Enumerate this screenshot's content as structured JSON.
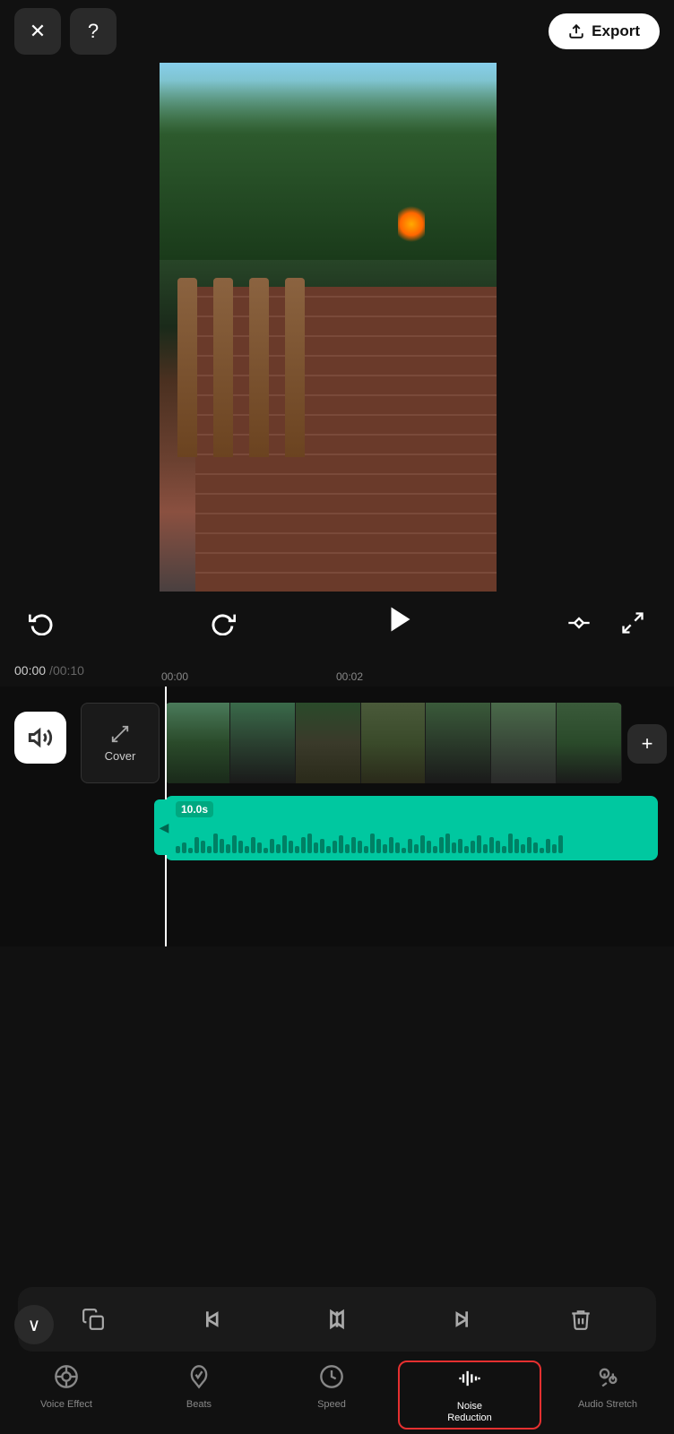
{
  "topBar": {
    "closeLabel": "✕",
    "helpLabel": "?",
    "exportLabel": "Export"
  },
  "playback": {
    "currentTime": "00:00",
    "totalTime": "00:10",
    "separator": "/",
    "markerTime1": "00:00",
    "markerTime2": "00:02"
  },
  "timeline": {
    "coverLabel": "Cover",
    "audioDuration": "10.0s",
    "addLabel": "+"
  },
  "toolbar": {
    "tools": [
      {
        "name": "copy",
        "icon": "⊕"
      },
      {
        "name": "trim-start",
        "icon": "⊣"
      },
      {
        "name": "split",
        "icon": "⊢⊣"
      },
      {
        "name": "trim-end",
        "icon": "⊢"
      },
      {
        "name": "delete",
        "icon": "🗑"
      }
    ]
  },
  "bottomNav": {
    "items": [
      {
        "id": "voice-effect",
        "label": "Voice Effect",
        "active": false,
        "highlighted": false
      },
      {
        "id": "beats",
        "label": "Beats",
        "active": false,
        "highlighted": false
      },
      {
        "id": "speed",
        "label": "Speed",
        "active": false,
        "highlighted": false
      },
      {
        "id": "noise-reduction",
        "label": "Noise\nReduction",
        "active": false,
        "highlighted": true
      },
      {
        "id": "audio-stretch",
        "label": "Audio Stretch",
        "active": false,
        "highlighted": false
      }
    ],
    "collapseLabel": "⌄"
  },
  "colors": {
    "accent": "#00C8A0",
    "bg": "#111111",
    "surface": "#1a1a1a",
    "highlight": "#e63030"
  }
}
